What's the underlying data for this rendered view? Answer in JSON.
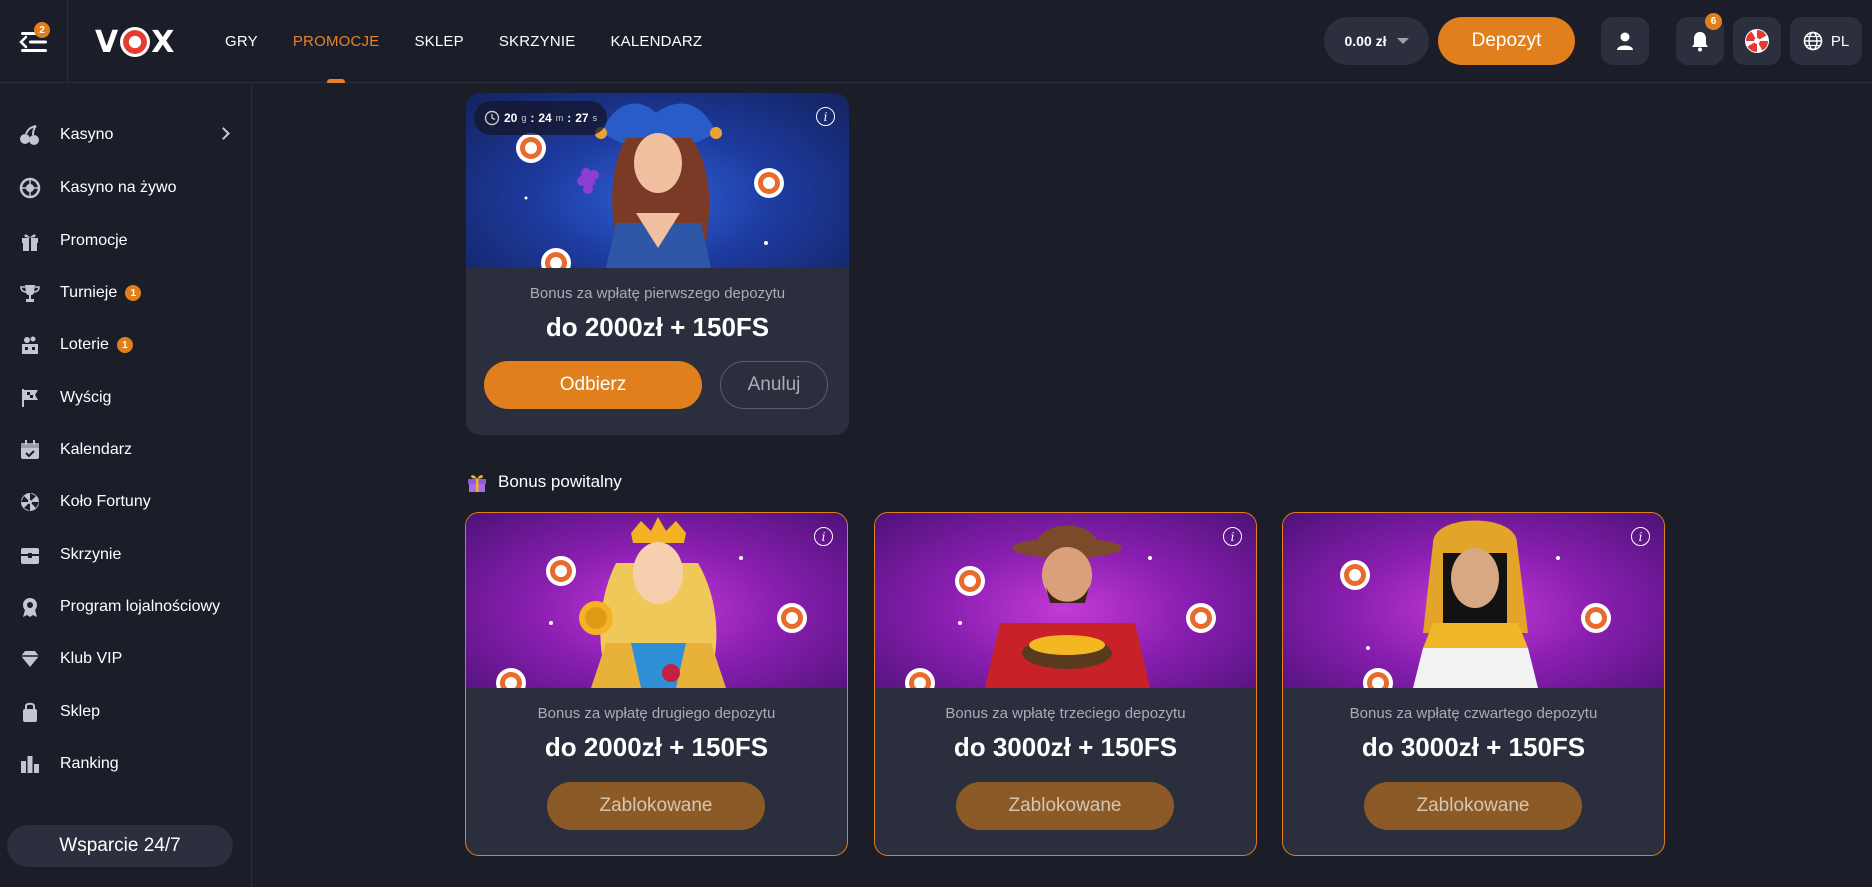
{
  "header": {
    "menu_badge": "2",
    "logo": "VOX",
    "nav": [
      {
        "label": "GRY",
        "active": false
      },
      {
        "label": "PROMOCJE",
        "active": true
      },
      {
        "label": "SKLEP",
        "active": false
      },
      {
        "label": "SKRZYNIE",
        "active": false
      },
      {
        "label": "KALENDARZ",
        "active": false
      }
    ],
    "balance": "0.00 zł",
    "deposit_label": "Depozyt",
    "notifications_badge": "6",
    "language": "PL",
    "accent_color": "#e07f1b"
  },
  "sidebar": {
    "items": [
      {
        "label": "Kasyno",
        "icon": "cherries-icon",
        "badge": null,
        "has_chevron": true
      },
      {
        "label": "Kasyno na żywo",
        "icon": "roulette-icon",
        "badge": null
      },
      {
        "label": "Promocje",
        "icon": "gift-icon",
        "badge": null
      },
      {
        "label": "Turnieje",
        "icon": "trophy-icon",
        "badge": "1"
      },
      {
        "label": "Loterie",
        "icon": "lottery-icon",
        "badge": "1"
      },
      {
        "label": "Wyścig",
        "icon": "race-flag-icon",
        "badge": null
      },
      {
        "label": "Kalendarz",
        "icon": "calendar-icon",
        "badge": null
      },
      {
        "label": "Koło Fortuny",
        "icon": "wheel-icon",
        "badge": null
      },
      {
        "label": "Skrzynie",
        "icon": "chest-icon",
        "badge": null
      },
      {
        "label": "Program lojalnościowy",
        "icon": "loyalty-badge-icon",
        "badge": null
      },
      {
        "label": "Klub VIP",
        "icon": "diamond-icon",
        "badge": null
      },
      {
        "label": "Sklep",
        "icon": "shopping-bag-icon",
        "badge": null
      },
      {
        "label": "Ranking",
        "icon": "ranking-icon",
        "badge": null
      }
    ],
    "support_label": "Wsparcie 24/7"
  },
  "active_bonus": {
    "timer": {
      "d": "20",
      "d_unit": "g",
      "h": "24",
      "h_unit": "m",
      "m": "27",
      "m_unit": "s"
    },
    "subtitle": "Bonus za wpłatę pierwszego depozytu",
    "amount": "do 2000zł + 150FS",
    "claim_label": "Odbierz",
    "cancel_label": "Anuluj"
  },
  "welcome_section": {
    "title": "Bonus powitalny",
    "cards": [
      {
        "subtitle": "Bonus za wpłatę drugiego depozytu",
        "amount": "do 2000zł + 150FS",
        "button": "Zablokowane"
      },
      {
        "subtitle": "Bonus za wpłatę trzeciego depozytu",
        "amount": "do 3000zł + 150FS",
        "button": "Zablokowane"
      },
      {
        "subtitle": "Bonus za wpłatę czwartego depozytu",
        "amount": "do 3000zł + 150FS",
        "button": "Zablokowane"
      }
    ]
  }
}
